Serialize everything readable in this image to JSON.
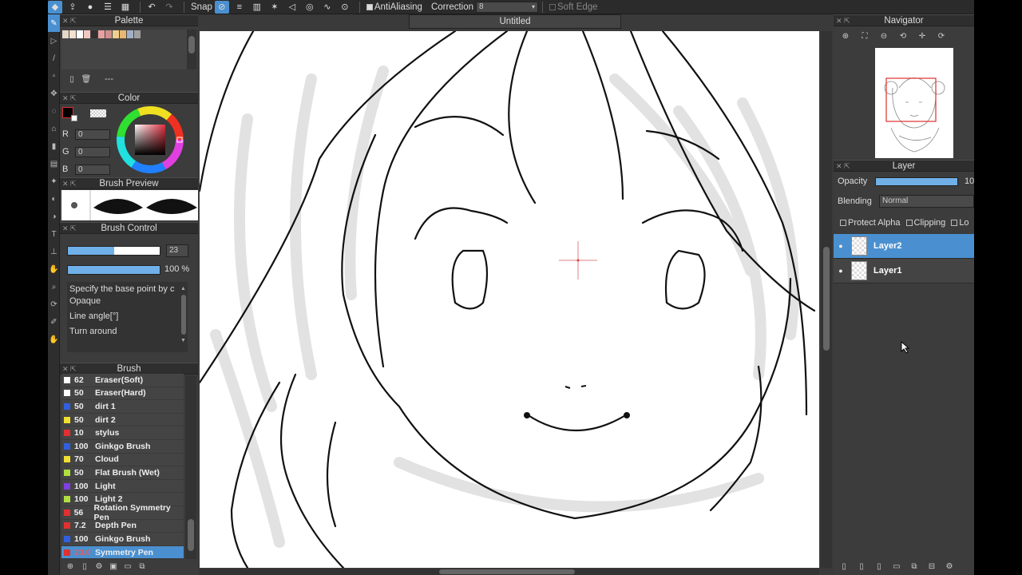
{
  "toolbar": {
    "snap_label": "Snap",
    "antialias_label": "AntiAliasing",
    "correction_label": "Correction",
    "correction_value": "8",
    "soft_edge_label": "Soft Edge"
  },
  "document": {
    "tab_title": "Untitled"
  },
  "palette": {
    "title": "Palette",
    "swatches": [
      "#e8d8c8",
      "#f4e0d0",
      "#ffffff",
      "#f0c8c0",
      "#303030",
      "#e8a0a0",
      "#d09090",
      "#f0d090",
      "#e8b870",
      "#a0b0c8",
      "#a0a0a0"
    ],
    "placeholder": "---"
  },
  "color": {
    "title": "Color",
    "r_label": "R",
    "r_value": "0",
    "g_label": "G",
    "g_value": "0",
    "b_label": "B",
    "b_value": "0"
  },
  "brush_preview": {
    "title": "Brush Preview"
  },
  "brush_control": {
    "title": "Brush Control",
    "size_value": "23",
    "size_fill": 0.5,
    "opacity_value": "100 %",
    "opacity_fill": 1.0,
    "desc_line": "Specify the base point by c",
    "opaque_label": "Opaque",
    "line_angle_label": "Line angle[°]",
    "turn_around_label": "Turn around"
  },
  "brush": {
    "title": "Brush",
    "items": [
      {
        "size": "62",
        "name": "Eraser(Soft)",
        "color": "#ffffff"
      },
      {
        "size": "50",
        "name": "Eraser(Hard)",
        "color": "#ffffff"
      },
      {
        "size": "50",
        "name": "dirt 1",
        "color": "#3060e0"
      },
      {
        "size": "50",
        "name": "dirt 2",
        "color": "#f0e030"
      },
      {
        "size": "10",
        "name": "stylus",
        "color": "#e03030"
      },
      {
        "size": "100",
        "name": "Ginkgo Brush",
        "color": "#3060e0"
      },
      {
        "size": "70",
        "name": "Cloud",
        "color": "#f0e030"
      },
      {
        "size": "50",
        "name": "Flat Brush (Wet)",
        "color": "#b0e040"
      },
      {
        "size": "100",
        "name": "Light",
        "color": "#8040e0"
      },
      {
        "size": "100",
        "name": "Light 2",
        "color": "#b0e040"
      },
      {
        "size": "56",
        "name": "Rotation Symmetry Pen",
        "color": "#e03030"
      },
      {
        "size": "7.2",
        "name": "Depth Pen",
        "color": "#e03030"
      },
      {
        "size": "100",
        "name": "Ginkgo Brush",
        "color": "#3060e0"
      },
      {
        "size": "23.0",
        "name": "Symmetry Pen",
        "color": "#e03030"
      }
    ]
  },
  "navigator": {
    "title": "Navigator"
  },
  "layer": {
    "title": "Layer",
    "opacity_label": "Opacity",
    "opacity_value": "10",
    "blending_label": "Blending",
    "blending_value": "Normal",
    "protect_alpha_label": "Protect Alpha",
    "clipping_label": "Clipping",
    "lock_label": "Lo",
    "layers": [
      {
        "name": "Layer2",
        "selected": true
      },
      {
        "name": "Layer1",
        "selected": false
      }
    ]
  }
}
